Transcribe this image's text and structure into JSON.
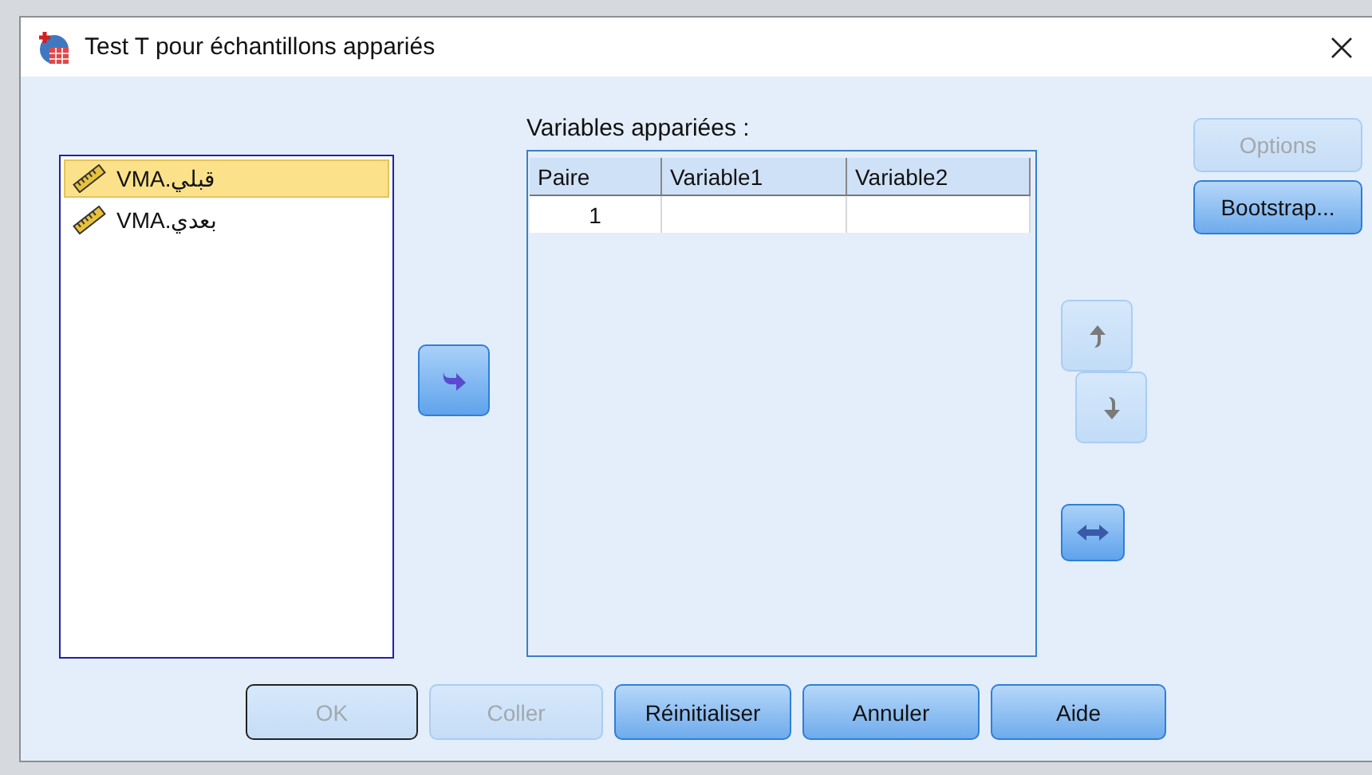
{
  "window": {
    "title": "Test T pour échantillons appariés"
  },
  "variables": [
    {
      "name": "VMA.قبلي",
      "selected": true
    },
    {
      "name": "VMA.بعدي",
      "selected": false
    }
  ],
  "transfer": {
    "disabled": false
  },
  "paired": {
    "label": "Variables appariées :",
    "columns": [
      "Paire",
      "Variable1",
      "Variable2"
    ],
    "rows": [
      {
        "pair": "1"
      }
    ]
  },
  "move_buttons": [
    {
      "kind": "up",
      "disabled": true
    },
    {
      "kind": "down",
      "disabled": true
    },
    {
      "kind": "swap",
      "disabled": false
    }
  ],
  "side_buttons": [
    {
      "label": "Options",
      "disabled": true
    },
    {
      "label": "Bootstrap...",
      "disabled": false
    }
  ],
  "footer_buttons": [
    {
      "label": "OK",
      "disabled": true,
      "default": true
    },
    {
      "label": "Coller",
      "disabled": true,
      "default": false
    },
    {
      "label": "Réinitialiser",
      "disabled": false,
      "default": false
    },
    {
      "label": "Annuler",
      "disabled": false,
      "default": false
    },
    {
      "label": "Aide",
      "disabled": false,
      "default": false
    }
  ]
}
